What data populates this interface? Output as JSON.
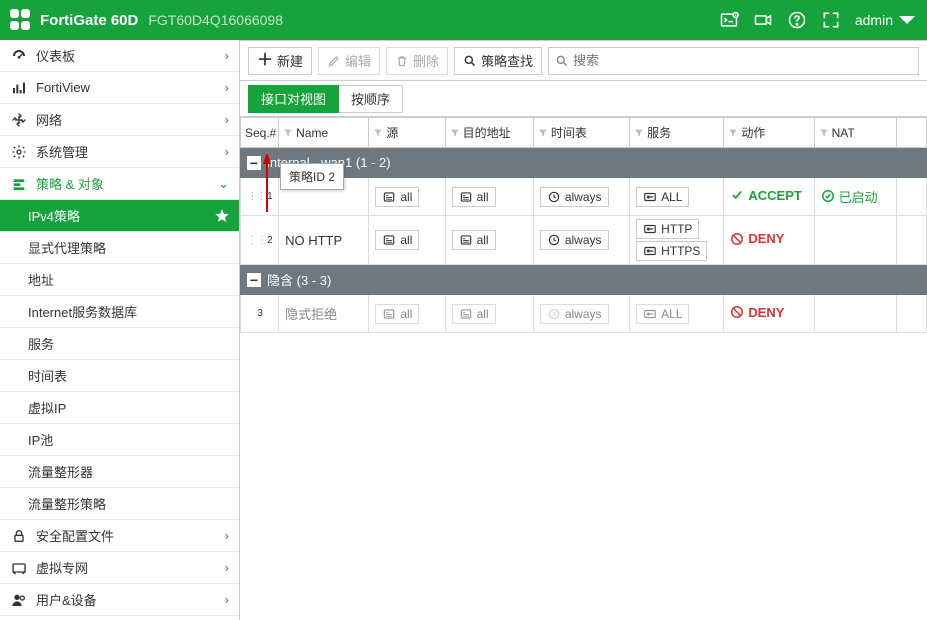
{
  "header": {
    "brand": "FortiGate 60D",
    "serial": "FGT60D4Q16066098",
    "admin": "admin"
  },
  "sidebar": {
    "items": [
      {
        "label": "仪表板",
        "expandable": true
      },
      {
        "label": "FortiView",
        "expandable": true
      },
      {
        "label": "网络",
        "expandable": true
      },
      {
        "label": "系统管理",
        "expandable": true
      },
      {
        "label": "策略 & 对象",
        "expandable": true,
        "active": true,
        "expanded": true,
        "children": [
          {
            "label": "IPv4策略",
            "selected": true,
            "starred": true
          },
          {
            "label": "显式代理策略"
          },
          {
            "label": "地址"
          },
          {
            "label": "Internet服务数据库"
          },
          {
            "label": "服务"
          },
          {
            "label": "时间表"
          },
          {
            "label": "虚拟IP"
          },
          {
            "label": "IP池"
          },
          {
            "label": "流量整形器"
          },
          {
            "label": "流量整形策略"
          }
        ]
      },
      {
        "label": "安全配置文件",
        "expandable": true
      },
      {
        "label": "虚拟专网",
        "expandable": true
      },
      {
        "label": "用户&设备",
        "expandable": true
      }
    ]
  },
  "toolbar": {
    "create": "新建",
    "edit": "编辑",
    "delete": "删除",
    "policy_lookup": "策略查找",
    "search_placeholder": "搜索"
  },
  "viewtabs": {
    "pair": "接口对视图",
    "sequence": "按顺序"
  },
  "columns": [
    "Seq.#",
    "Name",
    "源",
    "目的地址",
    "时间表",
    "服务",
    "动作",
    "NAT",
    ""
  ],
  "groups": [
    {
      "title": "internal - wan1 (1 - 2)",
      "rows": [
        {
          "seq": "1",
          "name": "",
          "src": "all",
          "dst": "all",
          "sched": "always",
          "svc": [
            "ALL"
          ],
          "action": "ACCEPT",
          "nat": "已启动"
        },
        {
          "seq": "2",
          "name": "NO HTTP",
          "src": "all",
          "dst": "all",
          "sched": "always",
          "svc": [
            "HTTP",
            "HTTPS"
          ],
          "action": "DENY",
          "nat": ""
        }
      ]
    },
    {
      "title": "隐含 (3 - 3)",
      "implicit": true,
      "rows": [
        {
          "seq": "3",
          "name": "隐式拒绝",
          "src": "all",
          "dst": "all",
          "sched": "always",
          "svc": [
            "ALL"
          ],
          "action": "DENY",
          "nat": ""
        }
      ]
    }
  ],
  "tooltip": "策略ID 2"
}
